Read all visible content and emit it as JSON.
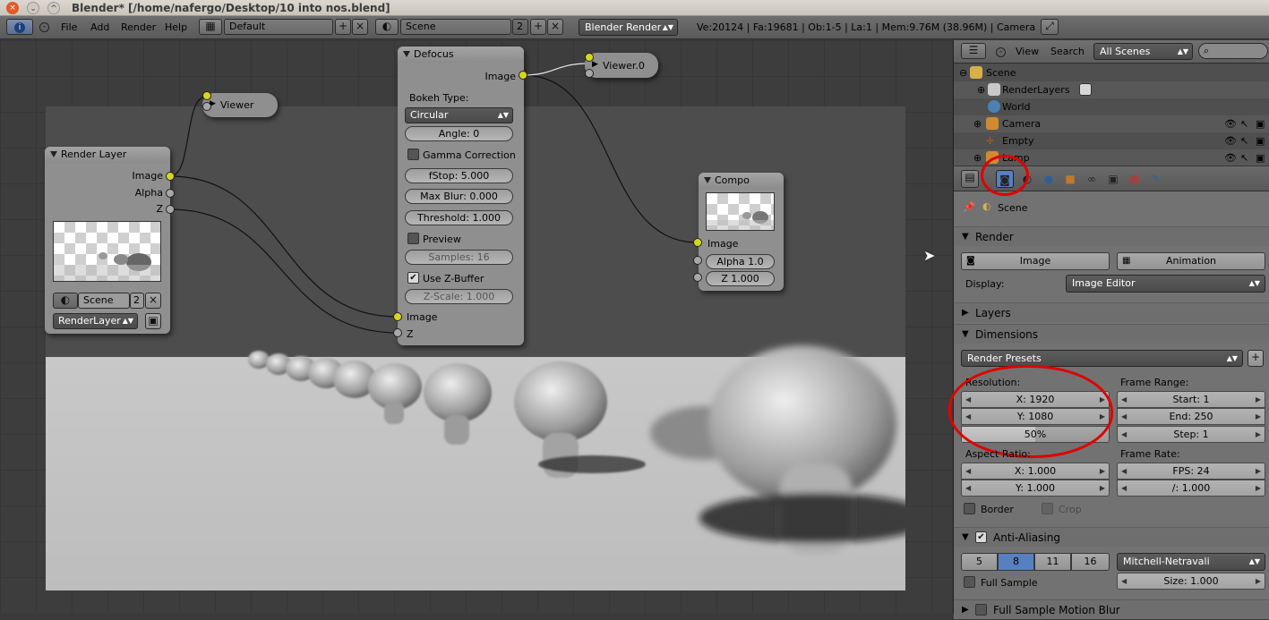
{
  "window": {
    "title": "Blender* [/home/nafergo/Desktop/10 into nos.blend]",
    "close": "×",
    "minimize": "⌄",
    "maximize": "^"
  },
  "infobar": {
    "menus": [
      "File",
      "Add",
      "Render",
      "Help"
    ],
    "layout": "Default",
    "scene": "Scene",
    "scene_users": "2",
    "engine": "Blender Render",
    "stats": "Ve:20124 | Fa:19681 | Ob:1-5 | La:1 | Mem:9.76M (38.96M) | Camera"
  },
  "nodes": {
    "viewer": {
      "title": "Viewer"
    },
    "viewer0": {
      "title": "Viewer.0"
    },
    "render_layer": {
      "title": "Render Layer",
      "outputs": [
        "Image",
        "Alpha",
        "Z"
      ],
      "scene": "Scene",
      "scene_users": "2",
      "layer": "RenderLayer"
    },
    "defocus": {
      "title": "Defocus",
      "output": "Image",
      "bokeh_label": "Bokeh Type:",
      "bokeh": "Circular",
      "angle": "Angle: 0",
      "gamma": "Gamma Correction",
      "gamma_checked": false,
      "fstop": "fStop: 5.000",
      "max_blur": "Max Blur: 0.000",
      "threshold": "Threshold: 1.000",
      "preview": "Preview",
      "preview_checked": false,
      "samples": "Samples: 16",
      "use_zbuffer": "Use Z-Buffer",
      "use_zbuffer_checked": true,
      "zscale": "Z-Scale: 1.000",
      "inputs": [
        "Image",
        "Z"
      ]
    },
    "composite": {
      "title": "Compo",
      "inputs": [
        "Image"
      ],
      "alpha": "Alpha 1.0",
      "z": "Z 1.000"
    }
  },
  "outliner": {
    "menus": [
      "View",
      "Search"
    ],
    "display_mode": "All Scenes",
    "rows": [
      {
        "label": "Scene",
        "indent": 0
      },
      {
        "label": "RenderLayers",
        "indent": 1
      },
      {
        "label": "World",
        "indent": 1
      },
      {
        "label": "Camera",
        "indent": 1
      },
      {
        "label": "Empty",
        "indent": 1
      },
      {
        "label": "Lamp",
        "indent": 1
      }
    ]
  },
  "properties": {
    "context": "Scene",
    "render": {
      "title": "Render",
      "image_button": "Image",
      "animation_button": "Animation",
      "display_label": "Display:",
      "display_value": "Image Editor"
    },
    "layers": {
      "title": "Layers"
    },
    "dimensions": {
      "title": "Dimensions",
      "presets": "Render Presets",
      "resolution_label": "Resolution:",
      "res_x": "X: 1920",
      "res_y": "Y: 1080",
      "res_percent": "50%",
      "res_percent_value": 0.5,
      "frame_range_label": "Frame Range:",
      "start": "Start: 1",
      "end": "End: 250",
      "step": "Step: 1",
      "aspect_label": "Aspect Ratio:",
      "aspect_x": "X: 1.000",
      "aspect_y": "Y: 1.000",
      "frame_rate_label": "Frame Rate:",
      "fps": "FPS: 24",
      "fps_base": "/: 1.000",
      "border": "Border",
      "crop": "Crop"
    },
    "antialiasing": {
      "title": "Anti-Aliasing",
      "samples": [
        "5",
        "8",
        "11",
        "16"
      ],
      "selected": "8",
      "filter": "Mitchell-Netravali",
      "full_sample": "Full Sample",
      "size": "Size: 1.000"
    },
    "motion_blur": {
      "title": "Full Sample Motion Blur"
    }
  },
  "colors": {
    "socket_image": "#d6d61c",
    "annotation_red": "#e00000",
    "selected_blue": "#5680c2"
  }
}
